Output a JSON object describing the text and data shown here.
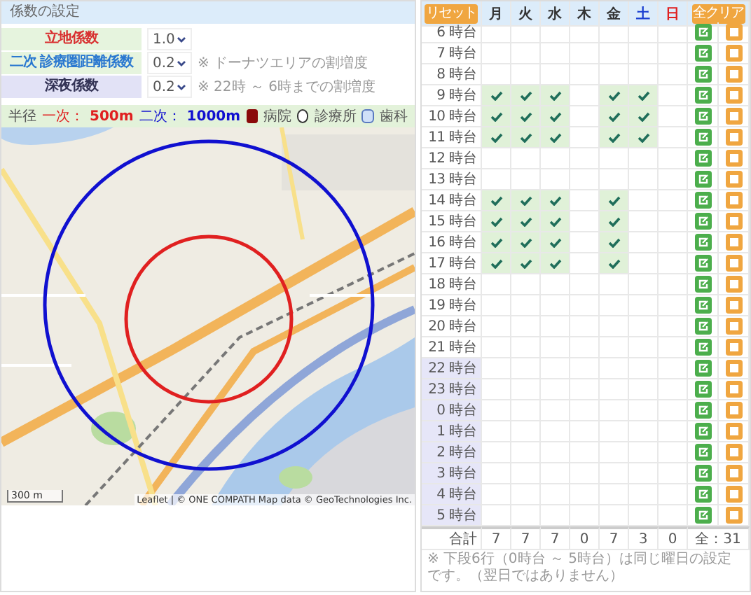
{
  "settings": {
    "title": "係数の設定",
    "factors": [
      {
        "label": "立地係数",
        "color": "#d83030",
        "night": false,
        "value": "1.0"
      },
      {
        "label": "二次 診療圏距離係数",
        "color": "#2a78d0",
        "night": false,
        "value": "0.2",
        "note": "※ ドーナツエリアの割増度"
      },
      {
        "label": "深夜係数",
        "color": "#333355",
        "night": true,
        "value": "0.2",
        "note": "※ 22時 ～ 6時までの割増度"
      }
    ],
    "legend": {
      "label": "半径",
      "radii": [
        {
          "label": "一次：",
          "value": "500m",
          "color": "#e02020"
        },
        {
          "label": "二次：",
          "value": "1000m",
          "color": "#1010d0"
        }
      ],
      "types": [
        {
          "kind": "hospital",
          "label": "病院"
        },
        {
          "kind": "clinic",
          "label": "診療所"
        },
        {
          "kind": "dental",
          "label": "歯科"
        }
      ]
    },
    "map": {
      "kind": "picture",
      "scale": "300 m",
      "attribution": "Leaflet | © ONE COMPATH Map data © GeoTechnologies Inc."
    }
  },
  "schedule": {
    "reset": "リセット",
    "clear_all": "全クリア",
    "days": [
      {
        "label": "月",
        "color": "#333333"
      },
      {
        "label": "火",
        "color": "#333333"
      },
      {
        "label": "水",
        "color": "#333333"
      },
      {
        "label": "木",
        "color": "#333333"
      },
      {
        "label": "金",
        "color": "#333333"
      },
      {
        "label": "土",
        "color": "#1a3fd0"
      },
      {
        "label": "日",
        "color": "#e02020"
      }
    ],
    "rows": [
      {
        "label": "6 時台",
        "night": false,
        "cells": [
          false,
          false,
          false,
          false,
          false,
          false,
          false
        ]
      },
      {
        "label": "7 時台",
        "night": false,
        "cells": [
          false,
          false,
          false,
          false,
          false,
          false,
          false
        ]
      },
      {
        "label": "8 時台",
        "night": false,
        "cells": [
          false,
          false,
          false,
          false,
          false,
          false,
          false
        ]
      },
      {
        "label": "9 時台",
        "night": false,
        "cells": [
          true,
          true,
          true,
          false,
          true,
          true,
          false
        ]
      },
      {
        "label": "10 時台",
        "night": false,
        "cells": [
          true,
          true,
          true,
          false,
          true,
          true,
          false
        ]
      },
      {
        "label": "11 時台",
        "night": false,
        "cells": [
          true,
          true,
          true,
          false,
          true,
          true,
          false
        ]
      },
      {
        "label": "12 時台",
        "night": false,
        "cells": [
          false,
          false,
          false,
          false,
          false,
          false,
          false
        ]
      },
      {
        "label": "13 時台",
        "night": false,
        "cells": [
          false,
          false,
          false,
          false,
          false,
          false,
          false
        ]
      },
      {
        "label": "14 時台",
        "night": false,
        "cells": [
          true,
          true,
          true,
          false,
          true,
          false,
          false
        ]
      },
      {
        "label": "15 時台",
        "night": false,
        "cells": [
          true,
          true,
          true,
          false,
          true,
          false,
          false
        ]
      },
      {
        "label": "16 時台",
        "night": false,
        "cells": [
          true,
          true,
          true,
          false,
          true,
          false,
          false
        ]
      },
      {
        "label": "17 時台",
        "night": false,
        "cells": [
          true,
          true,
          true,
          false,
          true,
          false,
          false
        ]
      },
      {
        "label": "18 時台",
        "night": false,
        "cells": [
          false,
          false,
          false,
          false,
          false,
          false,
          false
        ]
      },
      {
        "label": "19 時台",
        "night": false,
        "cells": [
          false,
          false,
          false,
          false,
          false,
          false,
          false
        ]
      },
      {
        "label": "20 時台",
        "night": false,
        "cells": [
          false,
          false,
          false,
          false,
          false,
          false,
          false
        ]
      },
      {
        "label": "21 時台",
        "night": false,
        "cells": [
          false,
          false,
          false,
          false,
          false,
          false,
          false
        ]
      },
      {
        "label": "22 時台",
        "night": true,
        "cells": [
          false,
          false,
          false,
          false,
          false,
          false,
          false
        ]
      },
      {
        "label": "23 時台",
        "night": true,
        "cells": [
          false,
          false,
          false,
          false,
          false,
          false,
          false
        ]
      },
      {
        "label": "0 時台",
        "night": true,
        "cells": [
          false,
          false,
          false,
          false,
          false,
          false,
          false
        ]
      },
      {
        "label": "1 時台",
        "night": true,
        "cells": [
          false,
          false,
          false,
          false,
          false,
          false,
          false
        ]
      },
      {
        "label": "2 時台",
        "night": true,
        "cells": [
          false,
          false,
          false,
          false,
          false,
          false,
          false
        ]
      },
      {
        "label": "3 時台",
        "night": true,
        "cells": [
          false,
          false,
          false,
          false,
          false,
          false,
          false
        ]
      },
      {
        "label": "4 時台",
        "night": true,
        "cells": [
          false,
          false,
          false,
          false,
          false,
          false,
          false
        ]
      },
      {
        "label": "5 時台",
        "night": true,
        "cells": [
          false,
          false,
          false,
          false,
          false,
          false,
          false
        ]
      }
    ],
    "totals": {
      "label": "合計",
      "values": [
        "7",
        "7",
        "7",
        "0",
        "7",
        "3",
        "0"
      ],
      "grand": "全：31"
    },
    "note": "※ 下段6行（0時台 ～ 5時台）は同じ曜日の設定です。（翌日ではありません）"
  }
}
